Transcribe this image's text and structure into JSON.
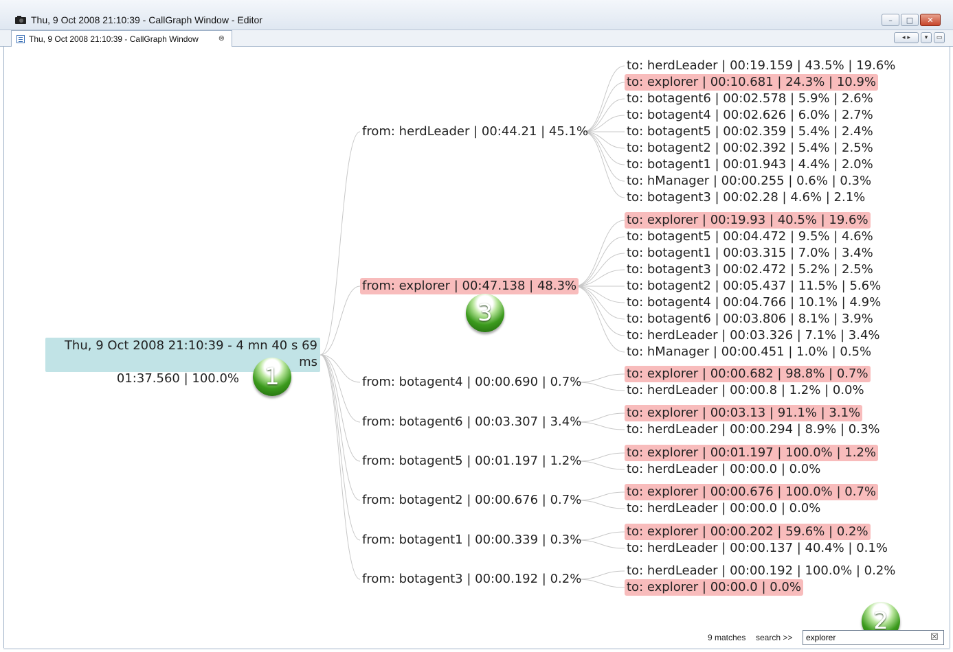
{
  "window": {
    "title": "Thu, 9 Oct 2008 21:10:39 - CallGraph Window - Editor",
    "buttons": [
      "minimize",
      "maximize",
      "close"
    ]
  },
  "tab": {
    "label": "Thu, 9 Oct 2008 21:10:39 - CallGraph Window",
    "close_glyph": "⊗"
  },
  "graph": {
    "root": {
      "line1": "Thu, 9 Oct 2008 21:10:39 - 4 mn  40 s 69 ms",
      "line2": "01:37.560 | 100.0%"
    },
    "markers": [
      "1",
      "2",
      "3"
    ],
    "groups": [
      {
        "from": "from: herdLeader | 00:44.21 | 45.1%",
        "from_hl": false,
        "to": [
          {
            "label": "to: herdLeader | 00:19.159 | 43.5% | 19.6%",
            "hl": false
          },
          {
            "label": "to: explorer | 00:10.681 | 24.3% | 10.9%",
            "hl": true
          },
          {
            "label": "to: botagent6 | 00:02.578 | 5.9% | 2.6%",
            "hl": false
          },
          {
            "label": "to: botagent4 | 00:02.626 | 6.0% | 2.7%",
            "hl": false
          },
          {
            "label": "to: botagent5 | 00:02.359 | 5.4% | 2.4%",
            "hl": false
          },
          {
            "label": "to: botagent2 | 00:02.392 | 5.4% | 2.5%",
            "hl": false
          },
          {
            "label": "to: botagent1 | 00:01.943 | 4.4% | 2.0%",
            "hl": false
          },
          {
            "label": "to: hManager | 00:00.255 | 0.6% | 0.3%",
            "hl": false
          },
          {
            "label": "to: botagent3 | 00:02.28 | 4.6% | 2.1%",
            "hl": false
          }
        ]
      },
      {
        "from": "from: explorer | 00:47.138 | 48.3%",
        "from_hl": true,
        "to": [
          {
            "label": "to: explorer | 00:19.93 | 40.5% | 19.6%",
            "hl": true
          },
          {
            "label": "to: botagent5 | 00:04.472 | 9.5% | 4.6%",
            "hl": false
          },
          {
            "label": "to: botagent1 | 00:03.315 | 7.0% | 3.4%",
            "hl": false
          },
          {
            "label": "to: botagent3 | 00:02.472 | 5.2% | 2.5%",
            "hl": false
          },
          {
            "label": "to: botagent2 | 00:05.437 | 11.5% | 5.6%",
            "hl": false
          },
          {
            "label": "to: botagent4 | 00:04.766 | 10.1% | 4.9%",
            "hl": false
          },
          {
            "label": "to: botagent6 | 00:03.806 | 8.1% | 3.9%",
            "hl": false
          },
          {
            "label": "to: herdLeader | 00:03.326 | 7.1% | 3.4%",
            "hl": false
          },
          {
            "label": "to: hManager | 00:00.451 | 1.0% | 0.5%",
            "hl": false
          }
        ]
      },
      {
        "from": "from: botagent4 | 00:00.690 | 0.7%",
        "from_hl": false,
        "to": [
          {
            "label": "to: explorer | 00:00.682 | 98.8% | 0.7%",
            "hl": true
          },
          {
            "label": "to: herdLeader | 00:00.8 | 1.2% | 0.0%",
            "hl": false
          }
        ]
      },
      {
        "from": "from: botagent6 | 00:03.307 | 3.4%",
        "from_hl": false,
        "to": [
          {
            "label": "to: explorer | 00:03.13 | 91.1% | 3.1%",
            "hl": true
          },
          {
            "label": "to: herdLeader | 00:00.294 | 8.9% | 0.3%",
            "hl": false
          }
        ]
      },
      {
        "from": "from: botagent5 | 00:01.197 | 1.2%",
        "from_hl": false,
        "to": [
          {
            "label": "to: explorer | 00:01.197 | 100.0% | 1.2%",
            "hl": true
          },
          {
            "label": "to: herdLeader | 00:00.0 | 0.0%",
            "hl": false
          }
        ]
      },
      {
        "from": "from: botagent2 | 00:00.676 | 0.7%",
        "from_hl": false,
        "to": [
          {
            "label": "to: explorer | 00:00.676 | 100.0% | 0.7%",
            "hl": true
          },
          {
            "label": "to: herdLeader | 00:00.0 | 0.0%",
            "hl": false
          }
        ]
      },
      {
        "from": "from: botagent1 | 00:00.339 | 0.3%",
        "from_hl": false,
        "to": [
          {
            "label": "to: explorer | 00:00.202 | 59.6% | 0.2%",
            "hl": true
          },
          {
            "label": "to: herdLeader | 00:00.137 | 40.4% | 0.1%",
            "hl": false
          }
        ]
      },
      {
        "from": "from: botagent3 | 00:00.192 | 0.2%",
        "from_hl": false,
        "to": [
          {
            "label": "to: herdLeader | 00:00.192 | 100.0% | 0.2%",
            "hl": false
          },
          {
            "label": "to: explorer | 00:00.0 | 0.0%",
            "hl": true
          }
        ]
      }
    ]
  },
  "search": {
    "matches": "9 matches",
    "label": "search >>",
    "value": "explorer"
  },
  "colors": {
    "highlight": "#f8bcbc",
    "root_bg": "#c1e3e6",
    "edge": "#c8c8c8",
    "marker_green": "#3b9a1d"
  }
}
